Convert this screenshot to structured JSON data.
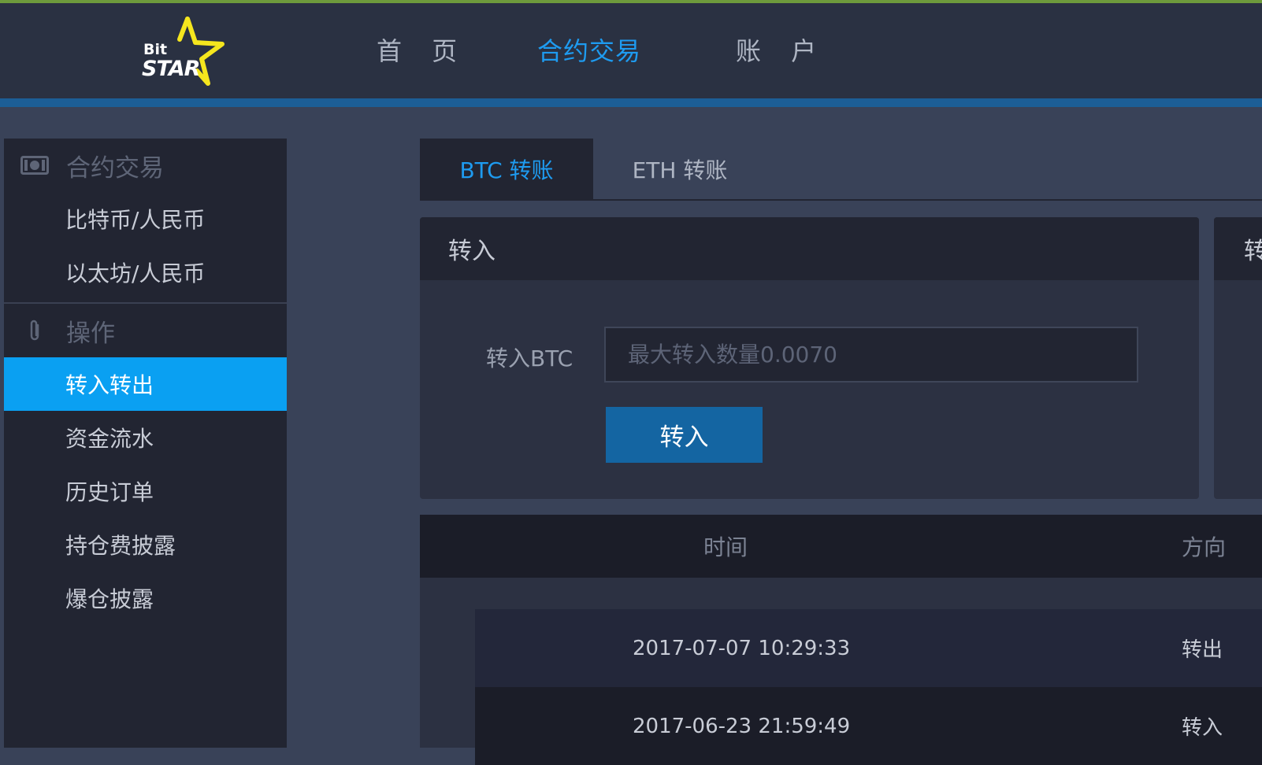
{
  "brand": {
    "logo_line1": "Bit",
    "logo_line2": "STAR",
    "accent_color": "#1e9bf0",
    "star_color": "#f5e61e"
  },
  "nav": {
    "items": [
      {
        "label": "首 页",
        "active": false
      },
      {
        "label": "合约交易",
        "active": true
      },
      {
        "label": "账 户",
        "active": false
      }
    ]
  },
  "sidebar": {
    "section_trading": {
      "title": "合约交易",
      "icon": "money-icon"
    },
    "trading_items": [
      {
        "label": "比特币/人民币"
      },
      {
        "label": "以太坊/人民币"
      }
    ],
    "section_ops": {
      "title": "操作",
      "icon": "paperclip-icon"
    },
    "ops_items": [
      {
        "label": "转入转出",
        "active": true
      },
      {
        "label": "资金流水"
      },
      {
        "label": "历史订单"
      },
      {
        "label": "持仓费披露"
      },
      {
        "label": "爆仓披露"
      }
    ]
  },
  "tabs": [
    {
      "label": "BTC 转账",
      "active": true
    },
    {
      "label": "ETH 转账",
      "active": false
    }
  ],
  "deposit_panel": {
    "title": "转入",
    "field_label": "转入BTC",
    "field_placeholder": "最大转入数量0.0070",
    "field_value": "",
    "button_label": "转入"
  },
  "second_panel": {
    "title": "转"
  },
  "table": {
    "columns": [
      "时间",
      "方向"
    ],
    "rows": [
      {
        "time": "2017-07-07 10:29:33",
        "direction": "转出"
      },
      {
        "time": "2017-06-23 21:59:49",
        "direction": "转入"
      }
    ]
  }
}
